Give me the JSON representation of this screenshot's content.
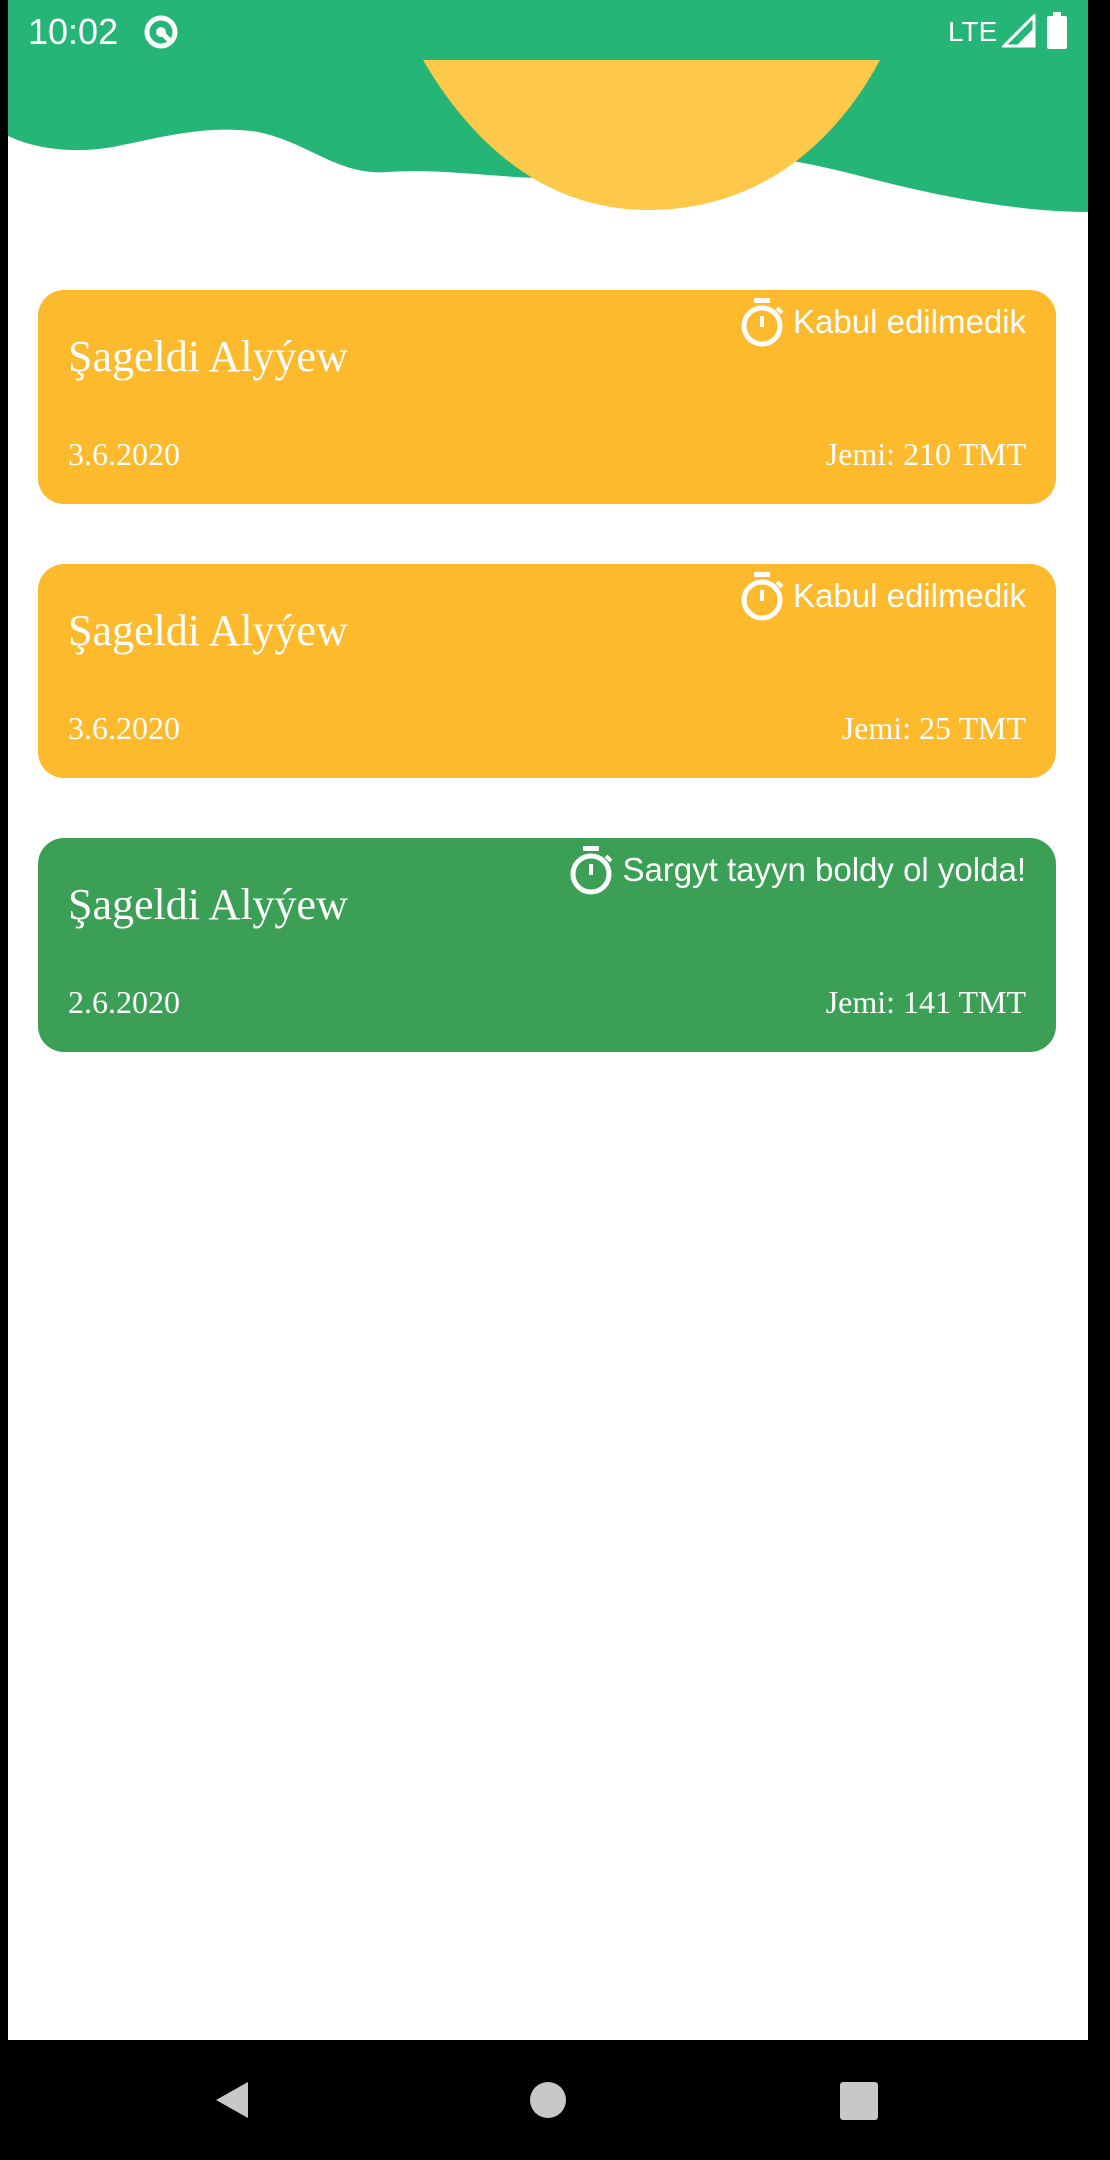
{
  "status_bar": {
    "time": "10:02",
    "network": "LTE",
    "icons": [
      "notification-icon",
      "signal-icon",
      "battery-icon"
    ]
  },
  "colors": {
    "header_green": "#25B577",
    "sun_yellow": "#FEC84A",
    "card_pending": "#FDBA2C",
    "card_ready": "#3BA055",
    "text": "#FFFFFF"
  },
  "orders": [
    {
      "name": "Şageldi Alyýew",
      "status": "Kabul edilmedik",
      "date": "3.6.2020",
      "total": "Jemi: 210 TMT",
      "state": "pending"
    },
    {
      "name": "Şageldi Alyýew",
      "status": "Kabul edilmedik",
      "date": "3.6.2020",
      "total": "Jemi: 25 TMT",
      "state": "pending"
    },
    {
      "name": "Şageldi Alyýew",
      "status": "Sargyt tayyn boldy ol yolda!",
      "date": "2.6.2020",
      "total": "Jemi: 141 TMT",
      "state": "ready"
    }
  ],
  "nav_bar": {
    "icons": [
      "back-icon",
      "home-icon",
      "recents-icon"
    ]
  }
}
